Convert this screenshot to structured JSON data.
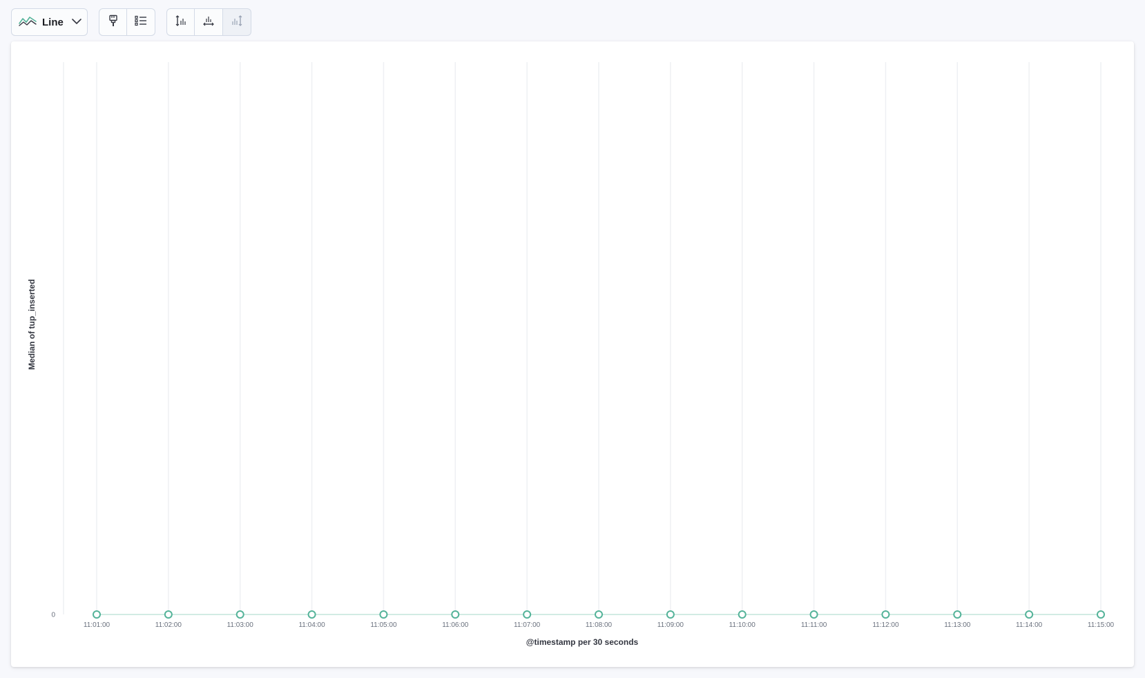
{
  "toolbar": {
    "chart_type_label": "Line",
    "chart_type_icon": "line-chart-icon",
    "style_icon": "paintbrush-icon",
    "legend_icon": "list-legend-icon",
    "left_axis_icon": "left-axis-icon",
    "bottom_axis_icon": "bottom-axis-icon",
    "right_axis_icon": "right-axis-icon"
  },
  "colors": {
    "series": "#54b399",
    "grid": "#eef0f3",
    "tick_text": "#69707d",
    "axis_title": "#343741"
  },
  "chart_data": {
    "type": "line",
    "title": "",
    "xlabel": "@timestamp per 30 seconds",
    "ylabel": "Median of tup_inserted",
    "x": [
      "11:01:00",
      "11:02:00",
      "11:03:00",
      "11:04:00",
      "11:05:00",
      "11:06:00",
      "11:07:00",
      "11:08:00",
      "11:09:00",
      "11:10:00",
      "11:11:00",
      "11:12:00",
      "11:13:00",
      "11:14:00",
      "11:15:00"
    ],
    "x_tick_labels": [
      "11:01:00",
      "11:02:00",
      "11:03:00",
      "11:04:00",
      "11:05:00",
      "11:06:00",
      "11:07:00",
      "11:08:00",
      "11:09:00",
      "11:10:00",
      "11:11:00",
      "11:12:00",
      "11:13:00",
      "11:14:00",
      "11:15:00"
    ],
    "y_tick_labels": [
      "0"
    ],
    "ylim": [
      0,
      1
    ],
    "grid": true,
    "series": [
      {
        "values": [
          0,
          0,
          0,
          0,
          0,
          0,
          0,
          0,
          0,
          0,
          0,
          0,
          0,
          0,
          0
        ]
      }
    ]
  }
}
